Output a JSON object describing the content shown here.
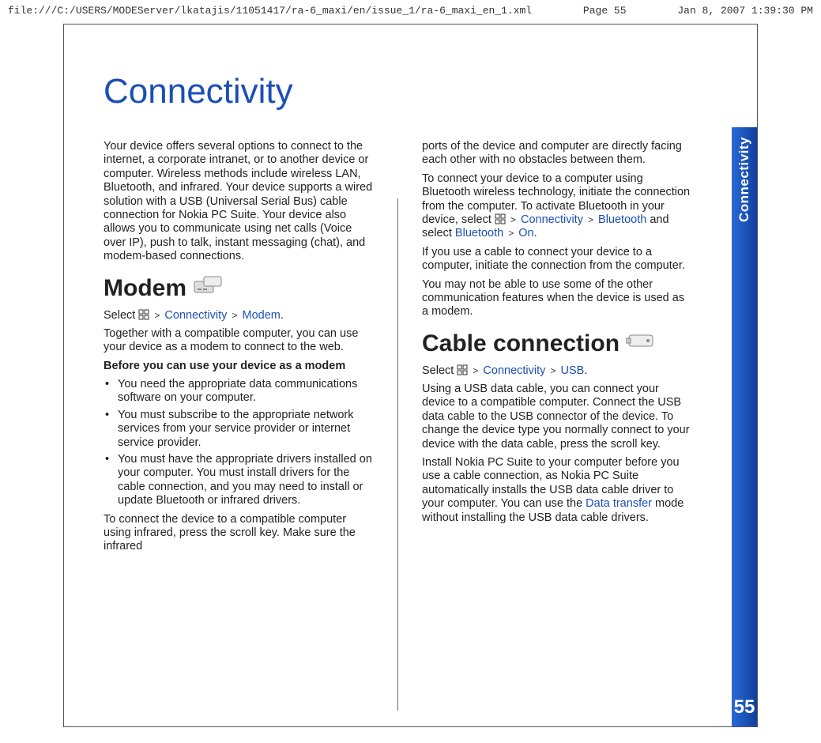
{
  "header": {
    "path": "file:///C:/USERS/MODEServer/lkatajis/11051417/ra-6_maxi/en/issue_1/ra-6_maxi_en_1.xml",
    "page": "Page 55",
    "timestamp": "Jan 8, 2007 1:39:30 PM"
  },
  "title": "Connectivity",
  "sideTab": {
    "label": "Connectivity",
    "pageNum": "55"
  },
  "col1": {
    "intro": "Your device offers several options to connect to the internet, a corporate intranet, or to another device or computer. Wireless methods include wireless LAN, Bluetooth, and infrared. Your device supports a wired solution with a USB (Universal Serial Bus) cable connection for Nokia PC Suite. Your device also allows you to communicate using net calls (Voice over IP), push to talk, instant messaging (chat), and modem-based connections.",
    "modem": {
      "heading": "Modem",
      "select_pre": "Select ",
      "nav1": "Connectivity",
      "nav2": "Modem",
      "period": ".",
      "p1": "Together with a compatible computer, you can use your device as a modem to connect to the web.",
      "before": "Before you can use your device as a modem",
      "b1": "You need the appropriate data communications software on your computer.",
      "b2": "You must subscribe to the appropriate network services from your service provider or internet service provider.",
      "b3": "You must have the appropriate drivers installed on your computer. You must install drivers for the cable connection, and you may need to install or update Bluetooth or infrared drivers.",
      "p2": "To connect the device to a compatible computer using infrared, press the scroll key. Make sure the infrared"
    }
  },
  "col2": {
    "ptop": "ports of the device and computer are directly facing each other with no obstacles between them.",
    "p2a": "To connect your device to a computer using Bluetooth wireless technology, initiate the connection from the computer. To activate Bluetooth in your device, select ",
    "nav_conn": "Connectivity",
    "nav_bt": "Bluetooth",
    "p2b": " and select ",
    "nav_bt2": "Bluetooth",
    "nav_on": "On",
    "p3": "If you use a cable to connect your device to a computer, initiate the connection from the computer.",
    "p4": "You may not be able to use some of the other communication features when the device is used as a modem.",
    "cable": {
      "heading": "Cable connection",
      "select_pre": "Select ",
      "nav1": "Connectivity",
      "nav2": "USB",
      "period": ".",
      "p1": "Using a USB data cable, you can connect your device to a compatible computer. Connect the USB data cable to the USB connector of the device. To change the device type you normally connect to your device with the data cable, press the scroll key.",
      "p2a": "Install Nokia PC Suite to your computer before you use a cable connection, as Nokia PC Suite automatically installs the USB data cable driver to your computer. You can use the ",
      "dt": "Data transfer",
      "p2b": " mode without installing the USB data cable drivers."
    }
  }
}
